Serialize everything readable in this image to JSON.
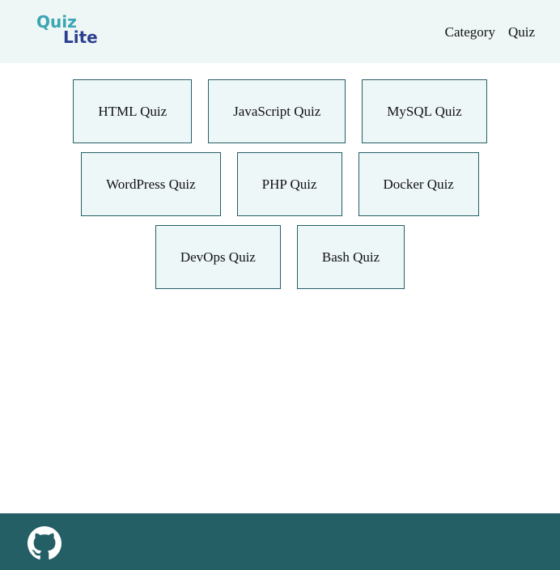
{
  "header": {
    "logo_line1": "Quiz",
    "logo_line2": "Lite",
    "nav": [
      {
        "label": "Category"
      },
      {
        "label": "Quiz"
      }
    ]
  },
  "quizzes": [
    {
      "label": "HTML Quiz"
    },
    {
      "label": "JavaScript Quiz"
    },
    {
      "label": "MySQL Quiz"
    },
    {
      "label": "WordPress Quiz"
    },
    {
      "label": "PHP Quiz"
    },
    {
      "label": "Docker Quiz"
    },
    {
      "label": "DevOps Quiz"
    },
    {
      "label": "Bash Quiz"
    }
  ],
  "footer": {
    "icon": "github-icon"
  },
  "colors": {
    "header_bg": "#eef6f6",
    "card_bg": "#eef7f8",
    "card_border": "#245f66",
    "footer_bg": "#245f66",
    "logo_top": "#3aa5b3",
    "logo_bottom": "#2c3f8f"
  }
}
